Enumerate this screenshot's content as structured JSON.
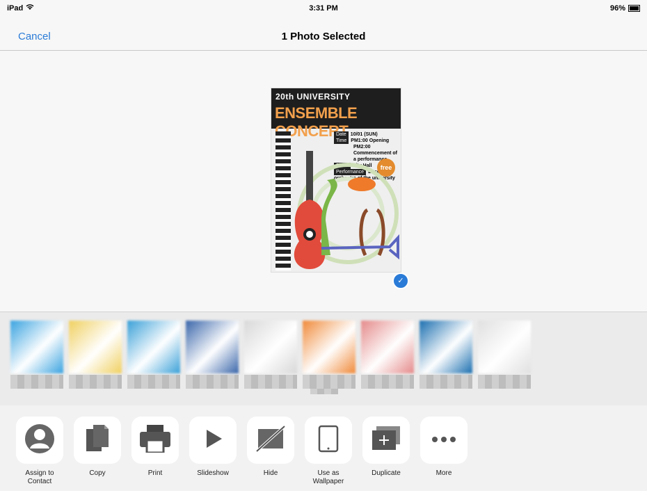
{
  "status_bar": {
    "device": "iPad",
    "time": "3:31 PM",
    "battery": "96%"
  },
  "nav": {
    "cancel_label": "Cancel",
    "title": "1 Photo Selected"
  },
  "poster": {
    "line1": "20th UNIVERSITY",
    "line2": "ENSEMBLE CONCERT",
    "rows": [
      {
        "tag": "Date",
        "text": "10/01 (SUN)"
      },
      {
        "tag": "Time",
        "text": "PM1:00 Opening"
      },
      {
        "tag": "",
        "text": "PM2:00 Commencement of a performance"
      },
      {
        "tag": "Place",
        "text": "City Hall"
      },
      {
        "tag": "Performance",
        "text": "Ensemble orchestra of the university"
      }
    ],
    "badge": "free"
  },
  "colors": {
    "accent": "#2a7bd7"
  },
  "app_tiles": [
    {
      "color": "#3aa3e0"
    },
    {
      "color": "#f0d060"
    },
    {
      "color": "#3aa0d8"
    },
    {
      "color": "#3a66aa"
    },
    {
      "color": "#d8d8d8"
    },
    {
      "color": "#f08a3a"
    },
    {
      "color": "#e58a8a"
    },
    {
      "color": "#1b6fb0"
    },
    {
      "color": "#e0e0e0"
    }
  ],
  "actions": [
    {
      "label": "Assign to Contact",
      "icon": "contact-icon"
    },
    {
      "label": "Copy",
      "icon": "copy-icon"
    },
    {
      "label": "Print",
      "icon": "print-icon"
    },
    {
      "label": "Slideshow",
      "icon": "play-icon"
    },
    {
      "label": "Hide",
      "icon": "hide-icon"
    },
    {
      "label": "Use as Wallpaper",
      "icon": "ipad-icon"
    },
    {
      "label": "Duplicate",
      "icon": "duplicate-icon"
    },
    {
      "label": "More",
      "icon": "more-icon"
    }
  ]
}
